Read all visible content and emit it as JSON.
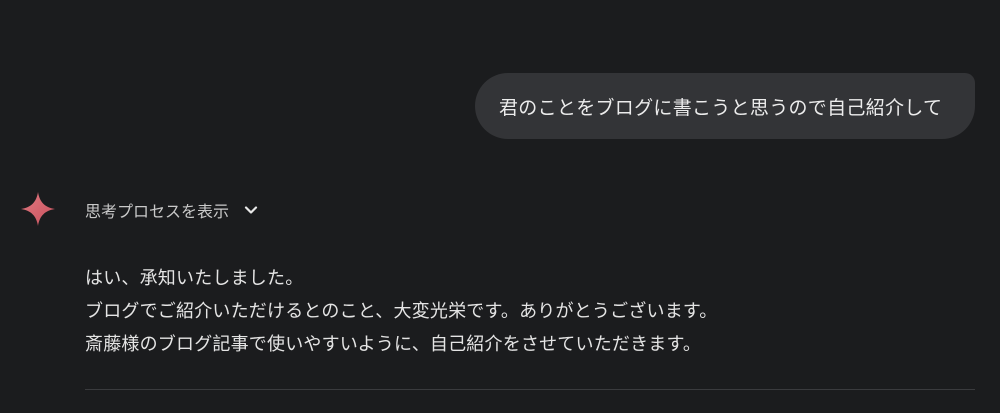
{
  "user_message": {
    "text": "君のことをブログに書こうと思うので自己紹介して"
  },
  "assistant": {
    "avatar_icon": "sparkle-icon",
    "avatar_color": "#d96570",
    "thinking_toggle": {
      "label": "思考プロセスを表示",
      "icon": "chevron-down-icon"
    },
    "response_lines": [
      "はい、承知いたしました。",
      "ブログでご紹介いただけるとのこと、大変光栄です。ありがとうございます。",
      "斎藤様のブログ記事で使いやすいように、自己紹介をさせていただきます。"
    ]
  },
  "colors": {
    "background": "#1b1c1e",
    "user_bubble": "#333437",
    "text": "#e4e4e4"
  }
}
